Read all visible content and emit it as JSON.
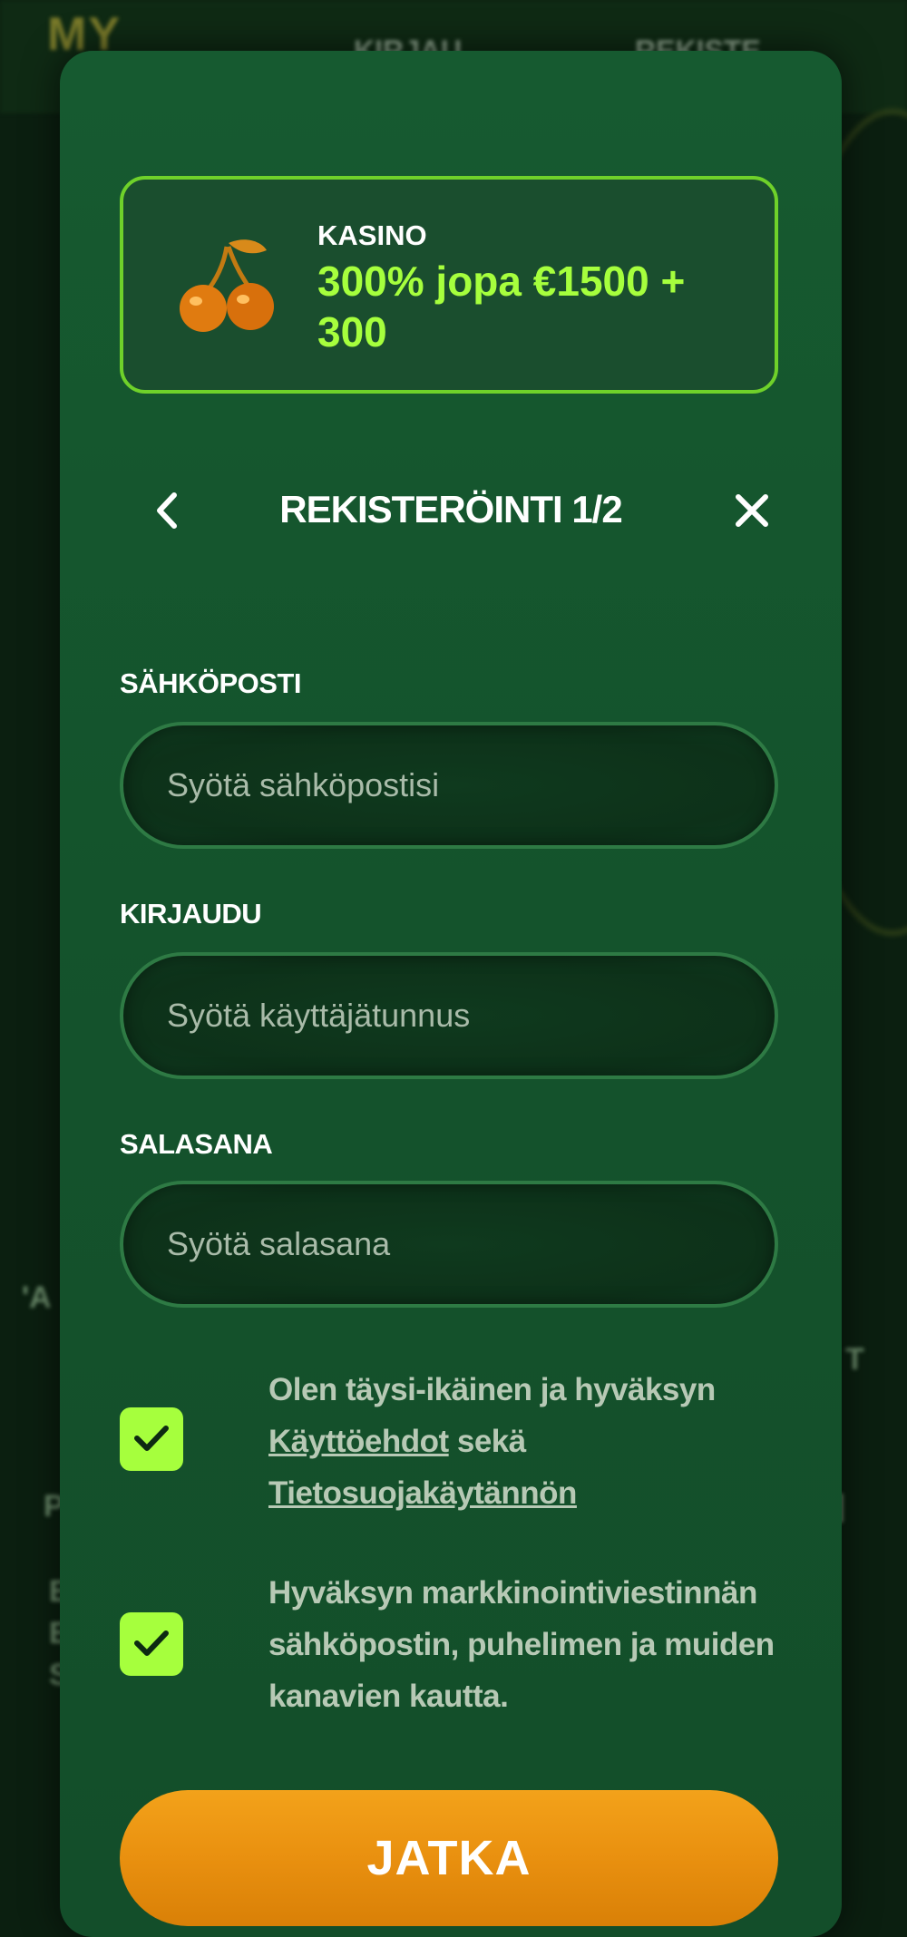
{
  "background": {
    "logo": "MY",
    "login_link": "KIRJAU",
    "register_link": "REKISTE",
    "fragments": [
      "'A",
      "T",
      "P",
      "]",
      "E",
      "E",
      "S"
    ]
  },
  "promo": {
    "icon": "cherry-icon",
    "category": "KASINO",
    "offer": "300% jopa €1500 + 300"
  },
  "header": {
    "back_icon": "chevron-left-icon",
    "title": "REKISTERÖINTI 1/2",
    "close_icon": "close-icon"
  },
  "form": {
    "email": {
      "label": "SÄHKÖPOSTI",
      "placeholder": "Syötä sähköpostisi",
      "value": ""
    },
    "username": {
      "label": "KIRJAUDU",
      "placeholder": "Syötä käyttäjätunnus",
      "value": ""
    },
    "password": {
      "label": "SALASANA",
      "placeholder": "Syötä salasana",
      "value": ""
    }
  },
  "consents": {
    "terms": {
      "checked": true,
      "text_before": "Olen täysi-ikäinen ja hyväksyn ",
      "terms_link": "Käyttöehdot",
      "text_middle": " sekä ",
      "privacy_link": "Tietosuojakäytännön"
    },
    "marketing": {
      "checked": true,
      "text": "Hyväksyn markkinointiviestinnän sähköpostin, puhelimen ja muiden kanavien kautta."
    }
  },
  "submit": {
    "label": "JATKA"
  },
  "colors": {
    "accent": "#a6ff3d",
    "modal_bg": "#165a30",
    "button": "#f3a21a"
  }
}
